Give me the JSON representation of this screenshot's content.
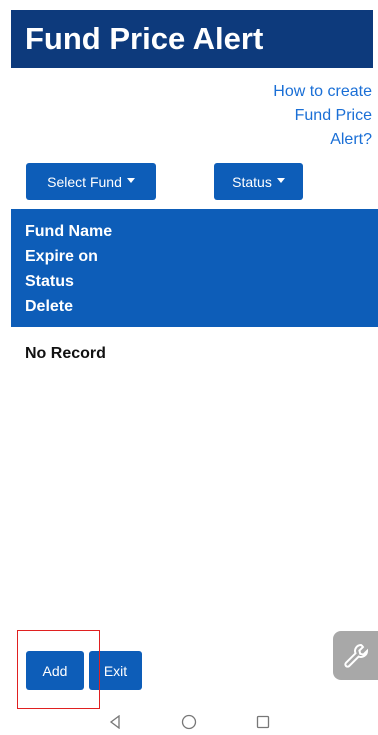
{
  "app": {
    "title": "Fund Price Alert"
  },
  "help_link": {
    "lines": [
      "How to create",
      "Fund Price",
      "Alert?"
    ]
  },
  "filters": {
    "select_fund_label": "Select Fund",
    "status_label": "Status"
  },
  "table": {
    "headers": [
      "Fund Name",
      "Expire on",
      "Status",
      "Delete"
    ],
    "empty_text": "No Record"
  },
  "actions": {
    "add_label": "Add",
    "exit_label": "Exit"
  },
  "colors": {
    "title_bar": "#0d3a7c",
    "primary": "#0d5db8",
    "link": "#1a6fd6",
    "highlight": "#e02020"
  },
  "icons": {
    "floating": "wrench-icon",
    "nav": [
      "back-icon",
      "home-icon",
      "recents-icon"
    ]
  }
}
